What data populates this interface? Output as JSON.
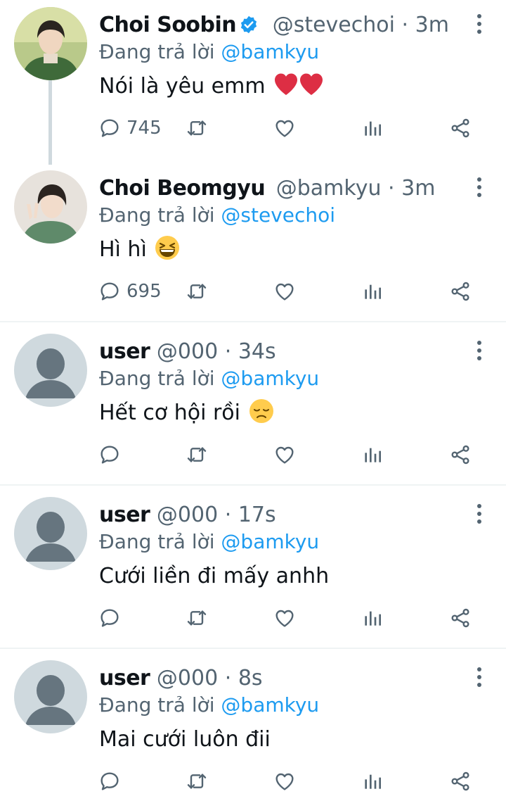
{
  "reply_prefix": "Đang trả lời",
  "tweets": [
    {
      "name": "Choi Soobin",
      "verified": true,
      "handle": "@stevechoi",
      "separator": "·",
      "time": "3m",
      "reply_to": "@bamkyu",
      "text": "Nói là yêu emm",
      "emoji": "red-heart x2",
      "reply_count": "745"
    },
    {
      "name": "Choi Beomgyu",
      "verified": false,
      "handle": "@bamkyu",
      "separator": "·",
      "time": "3m",
      "reply_to": "@stevechoi",
      "text": "Hì hì",
      "emoji": "grinning-squinting-face",
      "reply_count": "695"
    },
    {
      "name": "user",
      "handle": "@000",
      "separator": "·",
      "time": "34s",
      "reply_to": "@bamkyu",
      "text": "Hết cơ hội rồi",
      "emoji": "disappointed-face",
      "reply_count": ""
    },
    {
      "name": "user",
      "handle": "@000",
      "separator": "·",
      "time": "17s",
      "reply_to": "@bamkyu",
      "text": "Cưới liền đi mấy anhh",
      "reply_count": ""
    },
    {
      "name": "user",
      "handle": "@000",
      "separator": "·",
      "time": "8s",
      "reply_to": "@bamkyu",
      "text": "Mai cưới luôn đii",
      "reply_count": ""
    }
  ],
  "colors": {
    "link": "#1d9bf0",
    "secondary": "#536471",
    "text": "#0f1419",
    "divider": "#eff3f4",
    "thread_line": "#cfd9de"
  }
}
